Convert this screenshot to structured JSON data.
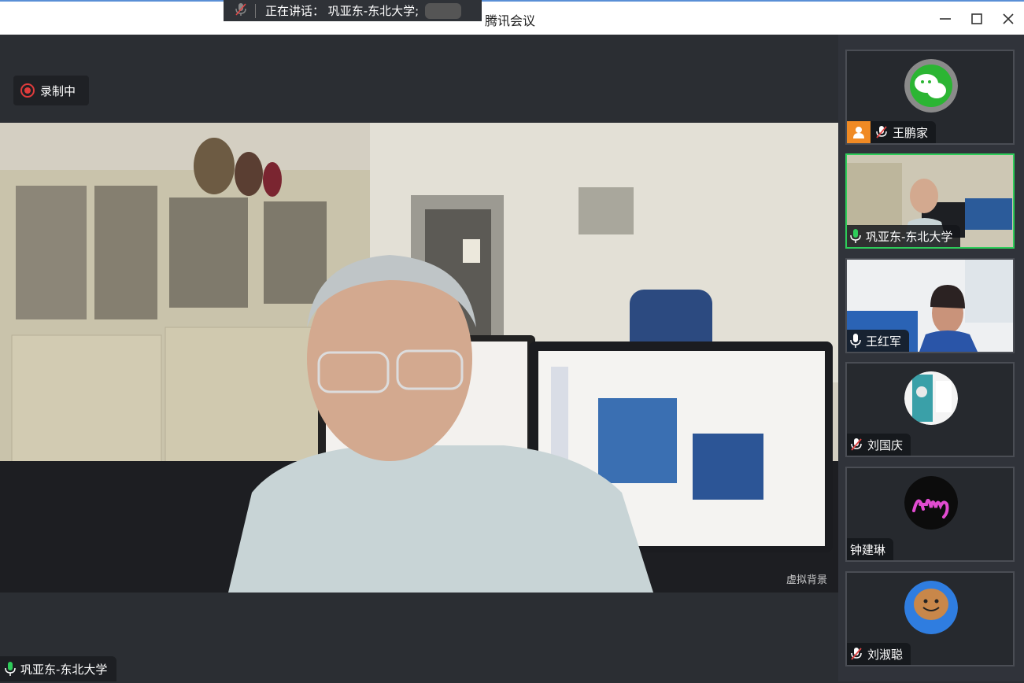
{
  "window": {
    "title": "腾讯会议",
    "controls": {
      "minimize": "minimize-icon",
      "maximize": "maximize-icon",
      "close": "close-icon"
    }
  },
  "speaking_banner": {
    "text": "正在讲话：  巩亚东-东北大学;"
  },
  "recording": {
    "label": "录制中",
    "color": "#e03c3c"
  },
  "main_video": {
    "speaker_name": "巩亚东-东北大学",
    "watermark": "虚拟背景",
    "mic_state": "on"
  },
  "participants": [
    {
      "name": "王鹏家",
      "mic": "muted",
      "avatar": "wechat-logo",
      "badge": "host-icon"
    },
    {
      "name": "巩亚东-东北大学",
      "mic": "on",
      "video": true,
      "active": true
    },
    {
      "name": "王红军",
      "mic": "on",
      "video": true
    },
    {
      "name": "刘国庆",
      "mic": "muted",
      "avatar": "book-cover"
    },
    {
      "name": "钟建琳",
      "mic": "none",
      "avatar": "amy-signature"
    },
    {
      "name": "刘淑聪",
      "mic": "muted",
      "avatar": "smiley-cookie"
    }
  ],
  "colors": {
    "active_border": "#2ecc5a",
    "mic_on": "#2ecc5a",
    "mic_muted": "#e04545",
    "accent": "#5a8fd6"
  }
}
